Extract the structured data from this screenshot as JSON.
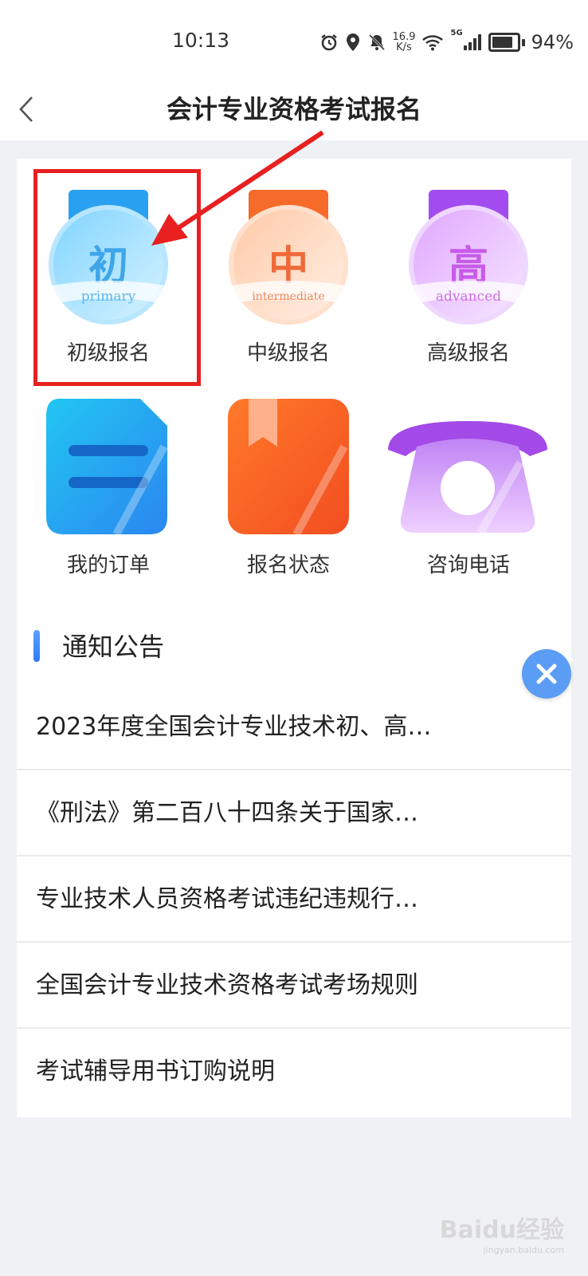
{
  "status_bar": {
    "time": "10:13",
    "net_speed_value": "16.9",
    "net_speed_unit": "K/s",
    "signal_label": "5G",
    "battery": "94%",
    "icons": [
      "alarm-icon",
      "location-icon",
      "bell-off-icon",
      "wifi-icon",
      "cellular-signal-icon",
      "battery-icon"
    ]
  },
  "nav": {
    "title": "会计专业资格考试报名",
    "back_icon": "chevron-left-icon"
  },
  "grid": {
    "row1": [
      {
        "label": "初级报名",
        "badge_char": "初",
        "badge_text": "primary",
        "color": "#3fb2f2",
        "highlighted": true
      },
      {
        "label": "中级报名",
        "badge_char": "中",
        "badge_text": "intermediate",
        "color": "#f5884f"
      },
      {
        "label": "高级报名",
        "badge_char": "高",
        "badge_text": "advanced",
        "color": "#c76ff0"
      }
    ],
    "row2": [
      {
        "label": "我的订单",
        "icon": "order-list-icon",
        "color": "#2aa3f0"
      },
      {
        "label": "报名状态",
        "icon": "bookmark-book-icon",
        "color": "#f55a22"
      },
      {
        "label": "咨询电话",
        "icon": "telephone-icon",
        "color": "#b35df0"
      }
    ]
  },
  "annotation": {
    "highlight_color": "#e82020"
  },
  "notices": {
    "title": "通知公告",
    "items": [
      "2023年度全国会计专业技术初、高…",
      "《刑法》第二百八十四条关于国家…",
      "专业技术人员资格考试违纪违规行…",
      "全国会计专业技术资格考试考场规则",
      "考试辅导用书订购说明"
    ]
  },
  "close_button": {
    "icon": "close-icon"
  },
  "watermark": {
    "text": "Baidu经验",
    "sub": "jingyan.baidu.com"
  }
}
